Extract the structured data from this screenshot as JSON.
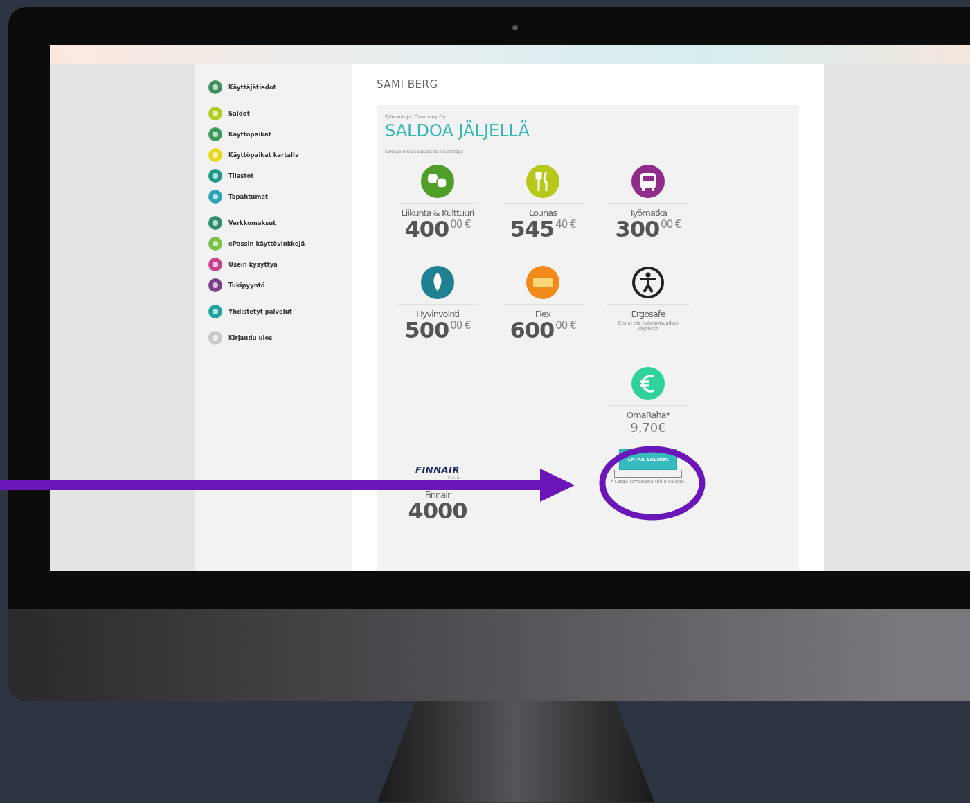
{
  "sidebar": {
    "groups": [
      {
        "items": [
          {
            "label": "Käyttäjätiedot",
            "color": "#3f8f5f"
          }
        ]
      },
      {
        "items": [
          {
            "label": "Saldot",
            "color": "#b5cc1e"
          },
          {
            "label": "Käyttöpaikat",
            "color": "#3c9a5a"
          },
          {
            "label": "Käyttöpaikat kartalla",
            "color": "#e8d81c"
          },
          {
            "label": "Tilastot",
            "color": "#1f9a8a"
          },
          {
            "label": "Tapahtumat",
            "color": "#2aa3b5"
          }
        ]
      },
      {
        "items": [
          {
            "label": "Verkkomaksut",
            "color": "#2f8f6a"
          },
          {
            "label": "ePassin käyttövinkkejä",
            "color": "#7cc04a"
          },
          {
            "label": "Usein kysyttyä",
            "color": "#c9408f"
          },
          {
            "label": "Tukipyyntö",
            "color": "#7a3f8a"
          }
        ]
      },
      {
        "items": [
          {
            "label": "Yhdistetyt palvelut",
            "color": "#1fa5a0"
          }
        ]
      },
      {
        "items": [
          {
            "label": "Kirjaudu ulos",
            "color": "#c8c8c8"
          }
        ]
      }
    ]
  },
  "user_name": "SAMI BERG",
  "panel": {
    "employer": "Työnantaja: Company Oy",
    "title": "SALDOA JÄLJELLÄ",
    "hint": "Klikkaa etua saadaksesi lisätietoja",
    "benefits": [
      {
        "kind": "amount",
        "label": "Liikunta & Kulttuuri",
        "whole": "400",
        "cents": "00 €",
        "color": "#4f9e2a"
      },
      {
        "kind": "amount",
        "label": "Lounas",
        "whole": "545",
        "cents": "40 €",
        "color": "#b8c81a"
      },
      {
        "kind": "amount",
        "label": "Työmatka",
        "whole": "300",
        "cents": "00 €",
        "color": "#8e2b8c"
      },
      {
        "kind": "amount",
        "label": "Hyvinvointi",
        "whole": "500",
        "cents": "00 €",
        "color": "#1e8090"
      },
      {
        "kind": "amount",
        "label": "Flex",
        "whole": "600",
        "cents": "00 €",
        "color": "#f28a1a"
      },
      {
        "kind": "note",
        "label": "Ergosafe",
        "note": "Etu ei ole työnantajallasi käytössä",
        "color": "#222222"
      }
    ],
    "finnair": {
      "logo": "FINNAIR",
      "logo_sub": "PLUS",
      "label": "Finnair",
      "points": "4000"
    },
    "omaraha": {
      "label": "OmaRaha*",
      "amount": "9,70€",
      "color": "#2fd39a",
      "button": "LATAA SALDOA",
      "note": "* Lataa OmaRaha tilille saldoa."
    }
  }
}
